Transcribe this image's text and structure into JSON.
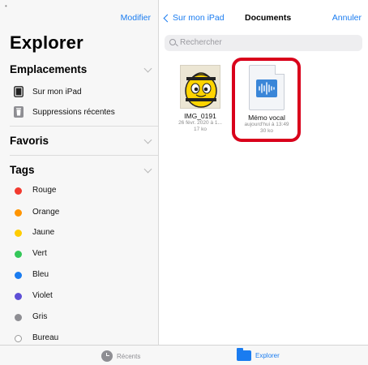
{
  "sidebar": {
    "top_marker": "•",
    "edit_label": "Modifier",
    "title": "Explorer",
    "locations": {
      "title": "Emplacements",
      "items": [
        {
          "label": "Sur mon iPad",
          "icon": "ipad-icon"
        },
        {
          "label": "Suppressions récentes",
          "icon": "trash-icon"
        }
      ]
    },
    "favorites": {
      "title": "Favoris"
    },
    "tags": {
      "title": "Tags",
      "items": [
        {
          "label": "Rouge",
          "color": "#f23a2f"
        },
        {
          "label": "Orange",
          "color": "#ff9500"
        },
        {
          "label": "Jaune",
          "color": "#ffcc00"
        },
        {
          "label": "Vert",
          "color": "#34c759"
        },
        {
          "label": "Bleu",
          "color": "#1a7cf0"
        },
        {
          "label": "Violet",
          "color": "#5e4fd6"
        },
        {
          "label": "Gris",
          "color": "#8e8e93"
        },
        {
          "label": "Bureau",
          "color": "hollow"
        }
      ]
    }
  },
  "nav": {
    "back_label": "Sur mon iPad",
    "title": "Documents",
    "cancel_label": "Annuler"
  },
  "search": {
    "placeholder": "Rechercher"
  },
  "files": [
    {
      "name": "IMG_0191",
      "date": "26 févr. 2020 à 1...",
      "size": "17 ko",
      "thumbnail": "bee-image"
    },
    {
      "name": "Mémo vocal",
      "date": "aujourd'hui à 13:49",
      "size": "30 ko",
      "thumbnail": "audio-document"
    }
  ],
  "tabbar": {
    "recent_label": "Récents",
    "explorer_label": "Explorer"
  },
  "colors": {
    "accent": "#1a7cf0",
    "highlight": "#d9001b"
  }
}
